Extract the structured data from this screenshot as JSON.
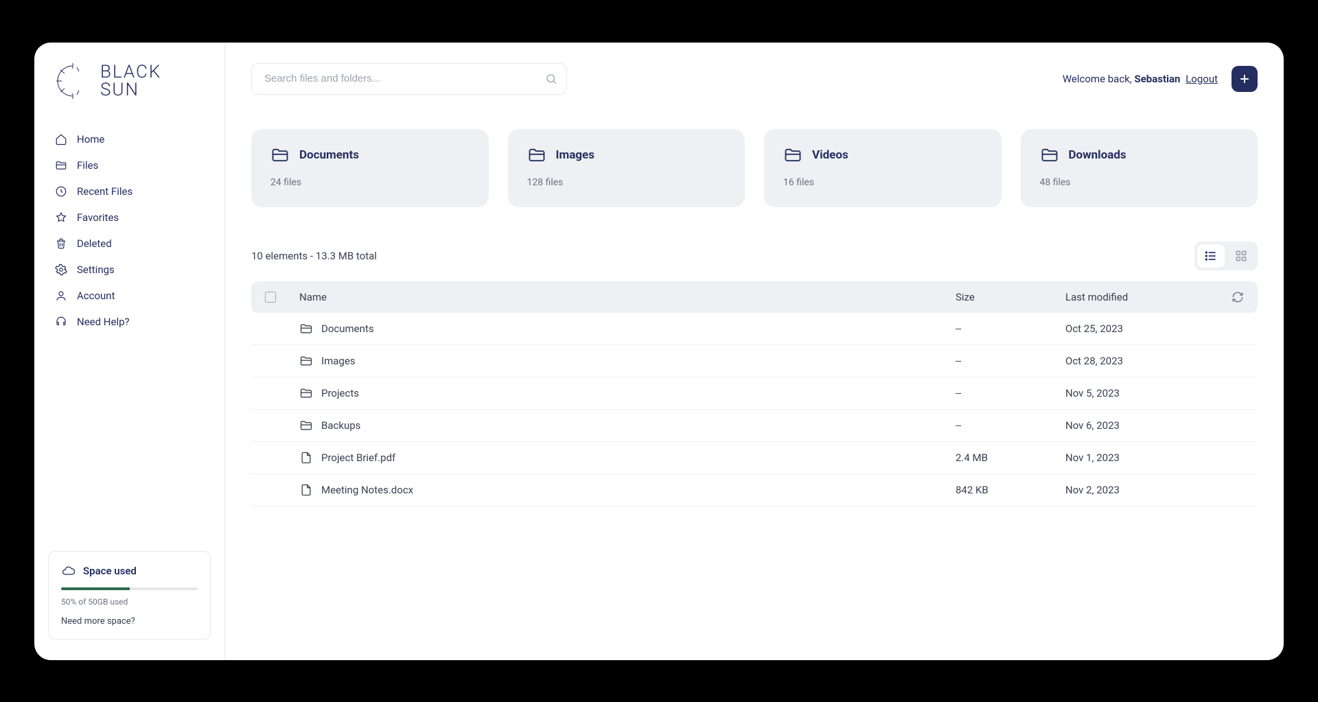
{
  "logo": {
    "line1": "BLACK",
    "line2": "SUN"
  },
  "nav": [
    {
      "label": "Home"
    },
    {
      "label": "Files"
    },
    {
      "label": "Recent Files"
    },
    {
      "label": "Favorites"
    },
    {
      "label": "Deleted"
    },
    {
      "label": "Settings"
    },
    {
      "label": "Account"
    },
    {
      "label": "Need Help?"
    }
  ],
  "space": {
    "title": "Space used",
    "percent": 50,
    "subtitle": "50% of 50GB used",
    "more": "Need more space?"
  },
  "search": {
    "placeholder": "Search files and folders..."
  },
  "welcome": {
    "prefix": "Welcome back, ",
    "name": "Sebastian",
    "logout": "Logout"
  },
  "cards": [
    {
      "name": "Documents",
      "count": "24 files"
    },
    {
      "name": "Images",
      "count": "128 files"
    },
    {
      "name": "Videos",
      "count": "16 files"
    },
    {
      "name": "Downloads",
      "count": "48 files"
    }
  ],
  "summary": "10 elements - 13.3 MB total",
  "columns": {
    "name": "Name",
    "size": "Size",
    "date": "Last modified"
  },
  "rows": [
    {
      "type": "folder",
      "name": "Documents",
      "size": "--",
      "date": "Oct 25, 2023"
    },
    {
      "type": "folder",
      "name": "Images",
      "size": "--",
      "date": "Oct 28, 2023"
    },
    {
      "type": "folder",
      "name": "Projects",
      "size": "--",
      "date": "Nov 5, 2023"
    },
    {
      "type": "folder",
      "name": "Backups",
      "size": "--",
      "date": "Nov 6, 2023"
    },
    {
      "type": "file",
      "name": "Project Brief.pdf",
      "size": "2.4 MB",
      "date": "Nov 1, 2023"
    },
    {
      "type": "file",
      "name": "Meeting Notes.docx",
      "size": "842 KB",
      "date": "Nov 2, 2023"
    }
  ]
}
